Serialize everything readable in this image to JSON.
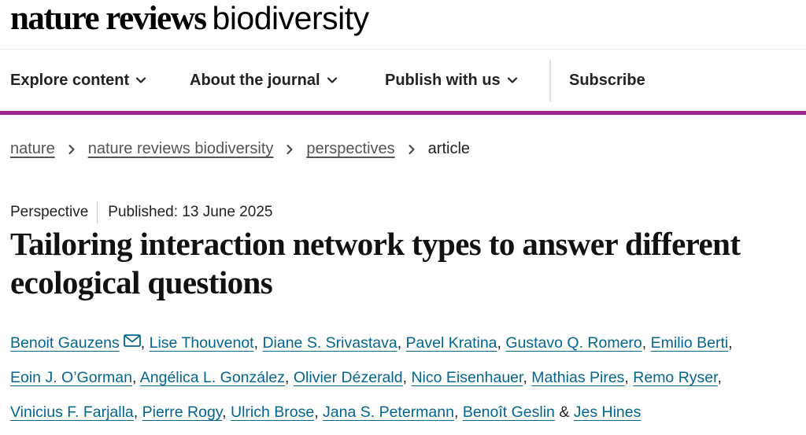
{
  "brand": {
    "name_bold": "nature reviews",
    "name_light": "biodiversity"
  },
  "nav": {
    "explore": "Explore content",
    "about": "About the journal",
    "publish": "Publish with us",
    "subscribe": "Subscribe"
  },
  "breadcrumb": {
    "items": [
      "nature",
      "nature reviews biodiversity",
      "perspectives"
    ],
    "current": "article"
  },
  "article": {
    "type": "Perspective",
    "published": "Published: 13 June 2025",
    "title": "Tailoring interaction network types to answer different ecological questions"
  },
  "authors": [
    "Benoit Gauzens",
    "Lise Thouvenot",
    "Diane S. Srivastava",
    "Pavel Kratina",
    "Gustavo Q. Romero",
    "Emilio Berti",
    "Eoin J. O’Gorman",
    "Angélica L. González",
    "Olivier Dézerald",
    "Nico Eisenhauer",
    "Mathias Pires",
    "Remo Ryser",
    "Vinicius F. Farjalla",
    "Pierre Rogy",
    "Ulrich Brose",
    "Jana S. Petermann",
    "Benoît Geslin",
    "Jes Hines"
  ],
  "authors_conjunction": "&",
  "colors": {
    "accent_bar": "#a0278f",
    "author_link": "#04668e",
    "breadcrumb_link": "#555555"
  },
  "icons": {
    "corresponding_author": "mail-icon",
    "nav_dropdown": "chevron-down-icon",
    "breadcrumb_separator": "chevron-right-icon"
  }
}
